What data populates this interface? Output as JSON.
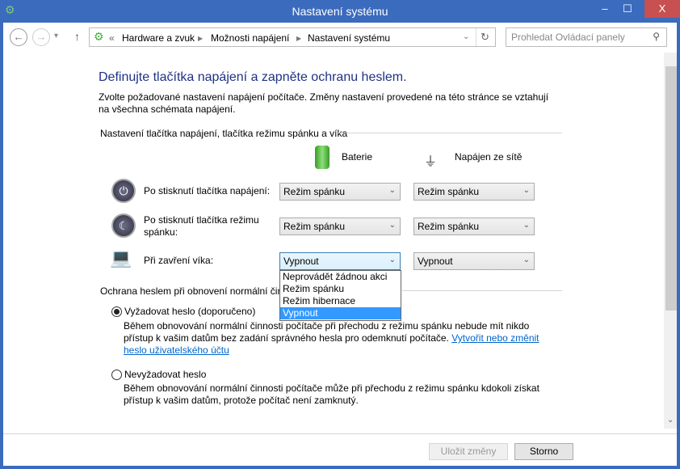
{
  "window": {
    "title": "Nastavení systému",
    "minimize": "–",
    "maximize": "☐",
    "close": "X"
  },
  "nav": {
    "back": "←",
    "forward": "→",
    "recent": "▾",
    "up": "↑",
    "breadcrumb": [
      "Hardware a zvuk",
      "Možnosti napájení",
      "Nastavení systému"
    ],
    "overflow": "«",
    "search_placeholder": "Prohledat Ovládací panely"
  },
  "main": {
    "heading": "Definujte tlačítka napájení a zapněte ochranu heslem.",
    "intro": "Zvolte požadované nastavení napájení počítače. Změny nastavení provedené na této stránce se vztahují na všechna schémata napájení.",
    "section1": "Nastavení tlačítka napájení, tlačítka režimu spánku a víka",
    "col_battery": "Baterie",
    "col_ac": "Napájen ze sítě",
    "rows": [
      {
        "label": "Po stisknutí tlačítka napájení:",
        "battery": "Režim spánku",
        "ac": "Režim spánku"
      },
      {
        "label": "Po stisknutí tlačítka režimu spánku:",
        "battery": "Režim spánku",
        "ac": "Režim spánku"
      },
      {
        "label": "Při zavření víka:",
        "battery": "Vypnout",
        "ac": "Vypnout"
      }
    ],
    "dropdown_options": [
      "Neprovádět žádnou akci",
      "Režim spánku",
      "Režim hibernace",
      "Vypnout"
    ],
    "dropdown_selected": "Vypnout",
    "section2": "Ochrana heslem při obnovení normální činnosti",
    "opt1": {
      "label": "Vyžadovat heslo (doporučeno)",
      "selected": true,
      "desc": "Během obnovování normální činnosti počítače při přechodu z režimu spánku nebude mít nikdo přístup k vašim datům bez zadání správného hesla pro odemknutí počítače.",
      "link": "Vytvořit nebo změnit heslo uživatelského účtu"
    },
    "opt2": {
      "label": "Nevyžadovat heslo",
      "selected": false,
      "desc": "Během obnovování normální činnosti počítače může při přechodu z režimu spánku kdokoli získat přístup k vašim datům, protože počítač není zamknutý."
    }
  },
  "footer": {
    "save": "Uložit změny",
    "cancel": "Storno"
  }
}
